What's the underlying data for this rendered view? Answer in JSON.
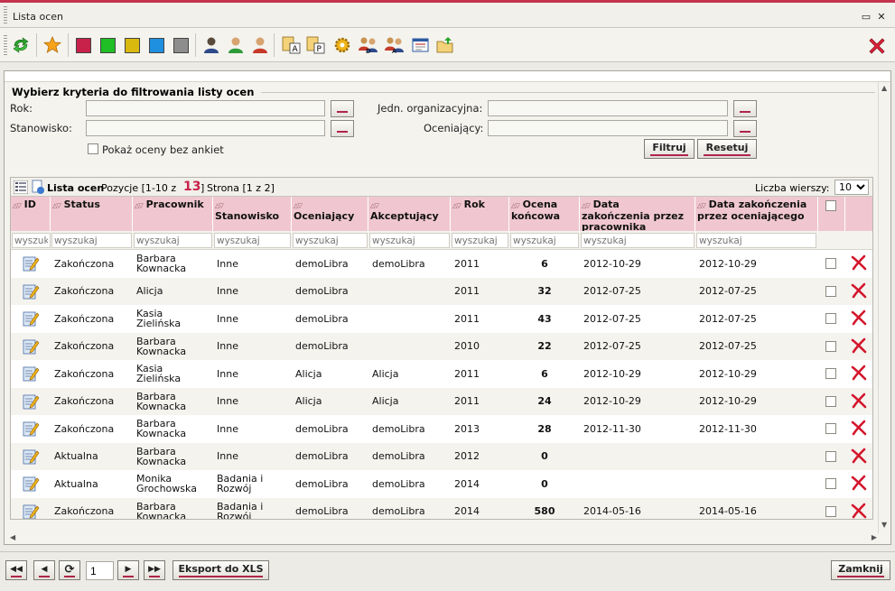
{
  "window": {
    "title": "Lista ocen",
    "minimize_glyph": "▭",
    "close_glyph": "✕"
  },
  "toolbar": {
    "icons": [
      "refresh-icon",
      "star-icon",
      "red-square-icon",
      "green-square-icon",
      "yellow-square-icon",
      "blue-square-icon",
      "gray-square-icon",
      "person-dark-icon",
      "person-green-icon",
      "person-red-icon",
      "document-a-icon",
      "document-p-icon",
      "gear-icon",
      "users-d-icon",
      "users-a-icon",
      "window-icon",
      "folder-icon",
      "close-icon"
    ],
    "colors": {
      "red": "#c8214a",
      "green": "#1fbf25",
      "yellow": "#d9b90e",
      "blue": "#1f8fe0",
      "gray": "#8d8d8d"
    }
  },
  "filter": {
    "legend": "Wybierz kryteria do filtrowania listy ocen",
    "rok_label": "Rok:",
    "stanowisko_label": "Stanowisko:",
    "jedn_label": "Jedn. organizacyjna:",
    "oceniajacy_label": "Oceniający:",
    "show_without_label": "Pokaż oceny bez ankiet",
    "filter_btn": "Filtruj",
    "reset_btn": "Resetuj"
  },
  "grid": {
    "title": "Lista ocen",
    "positions_prefix": "Pozycje [1-10 z",
    "total": "13",
    "positions_suffix": "]",
    "page_text": "Strona [1 z 2]",
    "rows_label": "Liczba wierszy:",
    "rows_value": "10",
    "filter_placeholder": "wyszukaj",
    "columns": {
      "id": "ID",
      "status": "Status",
      "pracownik": "Pracownik",
      "stanowisko": "Stanowisko",
      "oceniajacy": "Oceniający",
      "akceptujacy": "Akceptujący",
      "rok": "Rok",
      "ocena_1": "Ocena",
      "ocena_2": "końcowa",
      "dz1_1": "Data",
      "dz1_2": "zakończenia przez",
      "dz1_3": "pracownika",
      "dz2_1": "Data zakończenia",
      "dz2_2": "przez oceniającego"
    },
    "rows": [
      {
        "status": "Zakończona",
        "pracownik_1": "Barbara",
        "pracownik_2": "Kownacka",
        "stanowisko_1": "Inne",
        "stanowisko_2": "",
        "oceniajacy": "demoLibra",
        "akceptujacy": "demoLibra",
        "rok": "2011",
        "ocena": "6",
        "data1": "2012-10-29",
        "data2": "2012-10-29"
      },
      {
        "status": "Zakończona",
        "pracownik_1": "Alicja",
        "pracownik_2": "",
        "stanowisko_1": "Inne",
        "stanowisko_2": "",
        "oceniajacy": "demoLibra",
        "akceptujacy": "",
        "rok": "2011",
        "ocena": "32",
        "data1": "2012-07-25",
        "data2": "2012-07-25"
      },
      {
        "status": "Zakończona",
        "pracownik_1": "Kasia",
        "pracownik_2": "Zielińska",
        "stanowisko_1": "Inne",
        "stanowisko_2": "",
        "oceniajacy": "demoLibra",
        "akceptujacy": "",
        "rok": "2011",
        "ocena": "43",
        "data1": "2012-07-25",
        "data2": "2012-07-25"
      },
      {
        "status": "Zakończona",
        "pracownik_1": "Barbara",
        "pracownik_2": "Kownacka",
        "stanowisko_1": "Inne",
        "stanowisko_2": "",
        "oceniajacy": "demoLibra",
        "akceptujacy": "",
        "rok": "2010",
        "ocena": "22",
        "data1": "2012-07-25",
        "data2": "2012-07-25"
      },
      {
        "status": "Zakończona",
        "pracownik_1": "Kasia",
        "pracownik_2": "Zielińska",
        "stanowisko_1": "Inne",
        "stanowisko_2": "",
        "oceniajacy": "Alicja",
        "akceptujacy": "Alicja",
        "rok": "2011",
        "ocena": "6",
        "data1": "2012-10-29",
        "data2": "2012-10-29"
      },
      {
        "status": "Zakończona",
        "pracownik_1": "Barbara",
        "pracownik_2": "Kownacka",
        "stanowisko_1": "Inne",
        "stanowisko_2": "",
        "oceniajacy": "Alicja",
        "akceptujacy": "Alicja",
        "rok": "2011",
        "ocena": "24",
        "data1": "2012-10-29",
        "data2": "2012-10-29"
      },
      {
        "status": "Zakończona",
        "pracownik_1": "Barbara",
        "pracownik_2": "Kownacka",
        "stanowisko_1": "Inne",
        "stanowisko_2": "",
        "oceniajacy": "demoLibra",
        "akceptujacy": "demoLibra",
        "rok": "2013",
        "ocena": "28",
        "data1": "2012-11-30",
        "data2": "2012-11-30"
      },
      {
        "status": "Aktualna",
        "pracownik_1": "Barbara",
        "pracownik_2": "Kownacka",
        "stanowisko_1": "Inne",
        "stanowisko_2": "",
        "oceniajacy": "demoLibra",
        "akceptujacy": "demoLibra",
        "rok": "2012",
        "ocena": "0",
        "data1": "",
        "data2": ""
      },
      {
        "status": "Aktualna",
        "pracownik_1": "Monika",
        "pracownik_2": "Grochowska",
        "stanowisko_1": "Badania i",
        "stanowisko_2": "Rozwój",
        "oceniajacy": "demoLibra",
        "akceptujacy": "demoLibra",
        "rok": "2014",
        "ocena": "0",
        "data1": "",
        "data2": ""
      },
      {
        "status": "Zakończona",
        "pracownik_1": "Barbara",
        "pracownik_2": "Kownacka",
        "stanowisko_1": "Badania i",
        "stanowisko_2": "Rozwój",
        "oceniajacy": "demoLibra",
        "akceptujacy": "demoLibra",
        "rok": "2014",
        "ocena": "580",
        "data1": "2014-05-16",
        "data2": "2014-05-16"
      }
    ]
  },
  "footer": {
    "first_btn": "◀◀",
    "prev_btn": "◀",
    "refresh_btn": "⟳",
    "page_value": "1",
    "next_btn": "▶",
    "last_btn": "▶▶",
    "export_btn": "Eksport do XLS",
    "close_btn": "Zamknij"
  }
}
